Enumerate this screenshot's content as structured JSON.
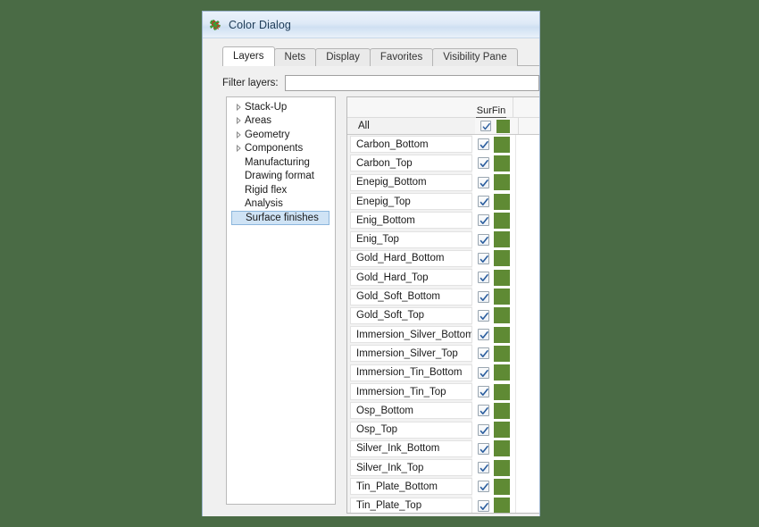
{
  "window": {
    "title": "Color Dialog",
    "icon": "app-logo-icon",
    "background_color": "#4a6b45",
    "titlebar_color": "#dfeaf7"
  },
  "tabs": [
    {
      "label": "Layers",
      "active": true
    },
    {
      "label": "Nets",
      "active": false
    },
    {
      "label": "Display",
      "active": false
    },
    {
      "label": "Favorites",
      "active": false
    },
    {
      "label": "Visibility Pane",
      "active": false
    }
  ],
  "filter": {
    "label": "Filter layers:",
    "value": "",
    "placeholder": ""
  },
  "tree": {
    "items": [
      {
        "label": "Stack-Up",
        "expandable": true,
        "selected": false
      },
      {
        "label": "Areas",
        "expandable": true,
        "selected": false
      },
      {
        "label": "Geometry",
        "expandable": true,
        "selected": false
      },
      {
        "label": "Components",
        "expandable": true,
        "selected": false
      },
      {
        "label": "Manufacturing",
        "expandable": false,
        "selected": false
      },
      {
        "label": "Drawing format",
        "expandable": false,
        "selected": false
      },
      {
        "label": "Rigid flex",
        "expandable": false,
        "selected": false
      },
      {
        "label": "Analysis",
        "expandable": false,
        "selected": false
      },
      {
        "label": "Surface finishes",
        "expandable": false,
        "selected": true
      }
    ]
  },
  "layer_list": {
    "column_header": "SurFin",
    "all_row": {
      "label": "All",
      "checked": true,
      "color": "#5f8a34"
    },
    "swatch_color": "#5f8a34",
    "rows": [
      {
        "label": "Carbon_Bottom",
        "checked": true,
        "color": "#5f8a34"
      },
      {
        "label": "Carbon_Top",
        "checked": true,
        "color": "#5f8a34"
      },
      {
        "label": "Enepig_Bottom",
        "checked": true,
        "color": "#5f8a34"
      },
      {
        "label": "Enepig_Top",
        "checked": true,
        "color": "#5f8a34"
      },
      {
        "label": "Enig_Bottom",
        "checked": true,
        "color": "#5f8a34"
      },
      {
        "label": "Enig_Top",
        "checked": true,
        "color": "#5f8a34"
      },
      {
        "label": "Gold_Hard_Bottom",
        "checked": true,
        "color": "#5f8a34"
      },
      {
        "label": "Gold_Hard_Top",
        "checked": true,
        "color": "#5f8a34"
      },
      {
        "label": "Gold_Soft_Bottom",
        "checked": true,
        "color": "#5f8a34"
      },
      {
        "label": "Gold_Soft_Top",
        "checked": true,
        "color": "#5f8a34"
      },
      {
        "label": "Immersion_Silver_Bottom",
        "checked": true,
        "color": "#5f8a34"
      },
      {
        "label": "Immersion_Silver_Top",
        "checked": true,
        "color": "#5f8a34"
      },
      {
        "label": "Immersion_Tin_Bottom",
        "checked": true,
        "color": "#5f8a34"
      },
      {
        "label": "Immersion_Tin_Top",
        "checked": true,
        "color": "#5f8a34"
      },
      {
        "label": "Osp_Bottom",
        "checked": true,
        "color": "#5f8a34"
      },
      {
        "label": "Osp_Top",
        "checked": true,
        "color": "#5f8a34"
      },
      {
        "label": "Silver_Ink_Bottom",
        "checked": true,
        "color": "#5f8a34"
      },
      {
        "label": "Silver_Ink_Top",
        "checked": true,
        "color": "#5f8a34"
      },
      {
        "label": "Tin_Plate_Bottom",
        "checked": true,
        "color": "#5f8a34"
      },
      {
        "label": "Tin_Plate_Top",
        "checked": true,
        "color": "#5f8a34"
      }
    ]
  }
}
